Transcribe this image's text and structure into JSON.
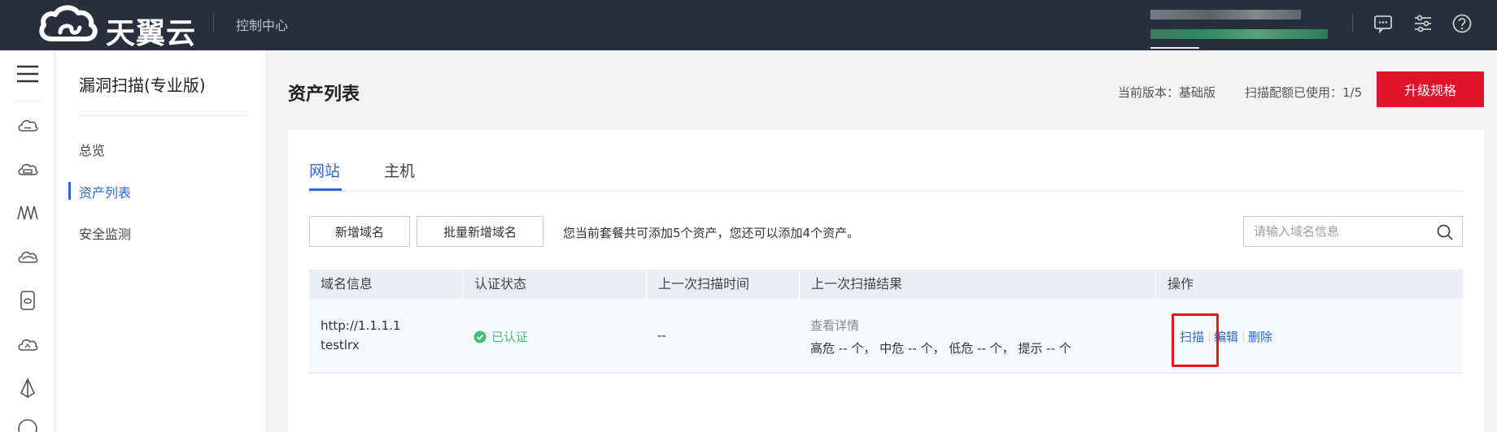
{
  "topbar": {
    "brand": "天翼云",
    "console_label": "控制中心",
    "icons": [
      "message-icon",
      "settings-sliders-icon",
      "help-icon"
    ]
  },
  "rail": {
    "icons": [
      "menu-icon",
      "cloud-server-icon",
      "cloud-host-icon",
      "network-icon",
      "cloud-icon",
      "storage-icon",
      "cloud-sync-icon",
      "deploy-icon",
      "ip-icon"
    ]
  },
  "sidebar": {
    "title": "漏洞扫描(专业版)",
    "items": [
      {
        "label": "总览",
        "active": false
      },
      {
        "label": "资产列表",
        "active": true
      },
      {
        "label": "安全监测",
        "active": false
      }
    ]
  },
  "main": {
    "title": "资产列表",
    "version": "当前版本：基础版",
    "quota": "扫描配额已使用：1/5",
    "upgrade_label": "升级规格"
  },
  "tabs": [
    {
      "label": "网站",
      "active": true
    },
    {
      "label": "主机",
      "active": false
    }
  ],
  "toolbar": {
    "add_domain": "新增域名",
    "batch_add": "批量新增域名",
    "hint": "您当前套餐共可添加5个资产，您还可以添加4个资产。",
    "search_placeholder": "请输入域名信息"
  },
  "table": {
    "headers": [
      "域名信息",
      "认证状态",
      "上一次扫描时间",
      "上一次扫描结果",
      "操作"
    ],
    "rows": [
      {
        "url": "http://1.1.1.1",
        "name": "testlrx",
        "status": "已认证",
        "last_scan_time": "--",
        "detail_link": "查看详情",
        "result_summary": "高危 -- 个， 中危 -- 个， 低危 -- 个， 提示 -- 个",
        "actions": [
          "扫描",
          "编辑",
          "删除"
        ]
      }
    ]
  },
  "colors": {
    "topbar": "#2a2f3e",
    "accent": "#2b6bd6",
    "upgrade": "#e0152b",
    "verified": "#3fbf73",
    "highlight": "#e8141c"
  }
}
